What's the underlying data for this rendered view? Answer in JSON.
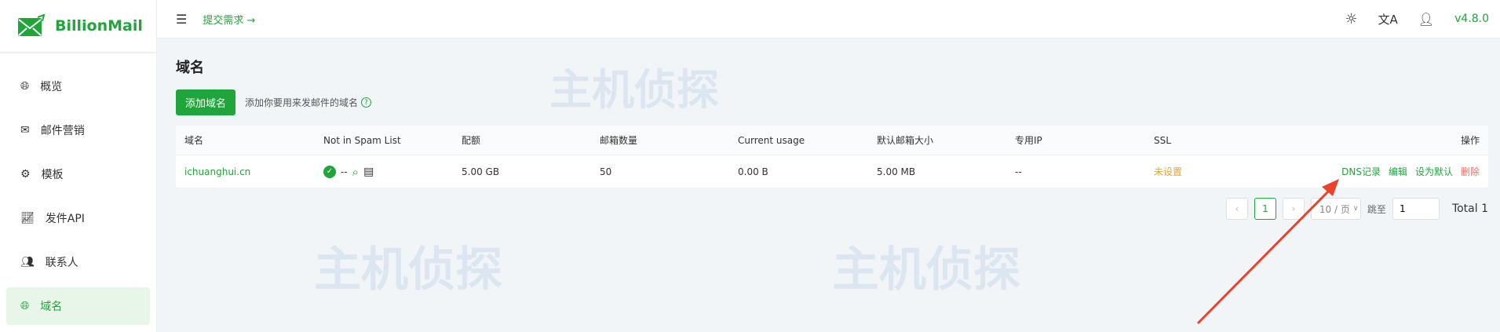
{
  "brand": {
    "name": "BillionMail"
  },
  "sidebar": {
    "items": [
      {
        "label": "概览",
        "icon": "globe-icon"
      },
      {
        "label": "邮件营销",
        "icon": "mail-icon"
      },
      {
        "label": "模板",
        "icon": "gear-icon"
      },
      {
        "label": "发件API",
        "icon": "chart-line-icon"
      },
      {
        "label": "联系人",
        "icon": "users-icon"
      },
      {
        "label": "域名",
        "icon": "globe-icon",
        "active": true
      }
    ]
  },
  "header": {
    "submit": "提交需求 →",
    "version": "v4.8.0"
  },
  "page": {
    "title": "域名",
    "add_button": "添加域名",
    "hint": "添加你要用来发邮件的域名"
  },
  "table": {
    "columns": [
      "域名",
      "Not in Spam List",
      "配额",
      "邮箱数量",
      "Current usage",
      "默认邮箱大小",
      "专用IP",
      "SSL",
      "操作"
    ],
    "rows": [
      {
        "domain": "ichuanghui.cn",
        "spam": "--",
        "quota": "5.00 GB",
        "mailboxes": "50",
        "usage": "0.00 B",
        "default_size": "5.00 MB",
        "ip": "--",
        "ssl": "未设置",
        "actions": [
          "DNS记录",
          "编辑",
          "设为默认",
          "删除"
        ]
      }
    ]
  },
  "pagination": {
    "current": "1",
    "page_size": "10 / 页",
    "jump_label": "跳至",
    "jump_value": "1",
    "total": "Total 1"
  },
  "colors": {
    "accent": "#20a53a",
    "warning": "#e6a23c",
    "danger": "#f56c6c",
    "annotation": "#e8432d"
  }
}
